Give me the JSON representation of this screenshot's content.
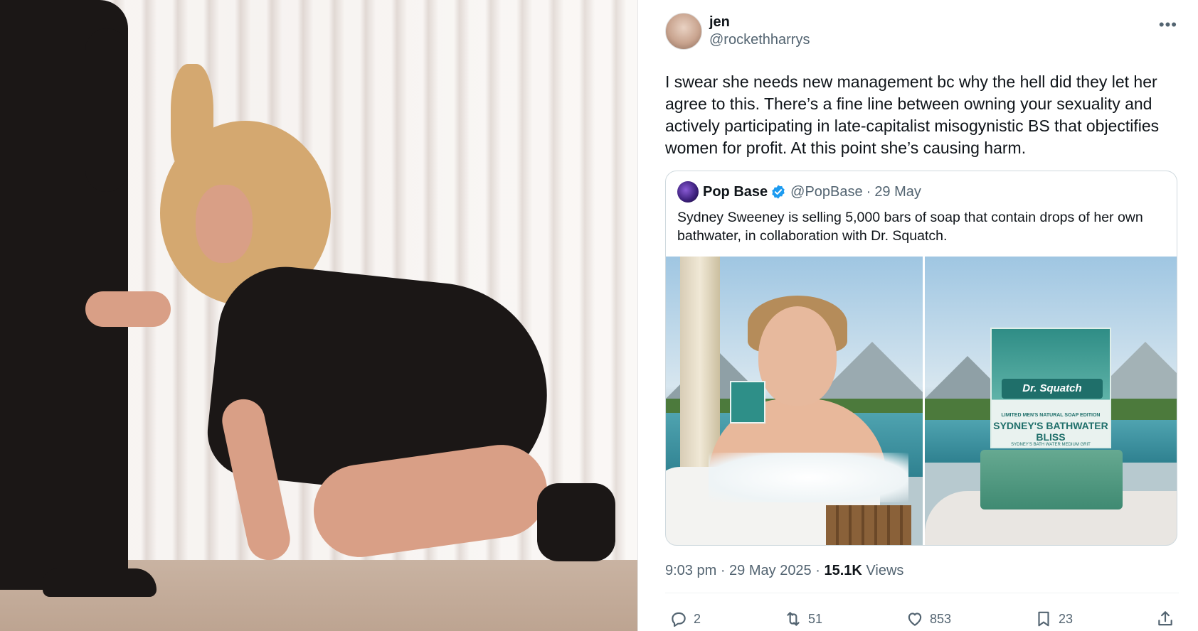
{
  "tweet": {
    "author": {
      "display_name": "jen",
      "handle": "@rockethharrys"
    },
    "more_icon": "ellipsis-icon",
    "text": "I swear she needs new management bc why the hell did they let her agree to this. There’s a fine line between owning your sexuality and actively participating in late-capitalist misogynistic BS that objectifies women for profit. At this point she’s causing harm.",
    "quote": {
      "display_name": "Pop Base",
      "handle": "@PopBase",
      "separator": "·",
      "date": "29 May",
      "text": "Sydney Sweeney is selling 5,000 bars of soap that contain drops of her own bathwater, in collaboration with Dr. Squatch.",
      "media": {
        "soap_brand": "Dr. Squatch",
        "soap_tag": "LIMITED   MEN'S NATURAL SOAP   EDITION",
        "soap_name": "SYDNEY'S BATHWATER BLISS",
        "soap_small": "SYDNEY'S BATH WATER   MEDIUM GRIT"
      }
    },
    "meta": {
      "time": "9:03 pm",
      "date": "29 May 2025",
      "separator": " · ",
      "views_count": "15.1K",
      "views_label": "Views"
    },
    "actions": {
      "replies": "2",
      "reposts": "51",
      "likes": "853",
      "bookmarks": "23"
    }
  },
  "colors": {
    "text_primary": "#0f1419",
    "text_secondary": "#536471",
    "border": "#cfd9de",
    "verified_blue": "#1d9bf0"
  }
}
